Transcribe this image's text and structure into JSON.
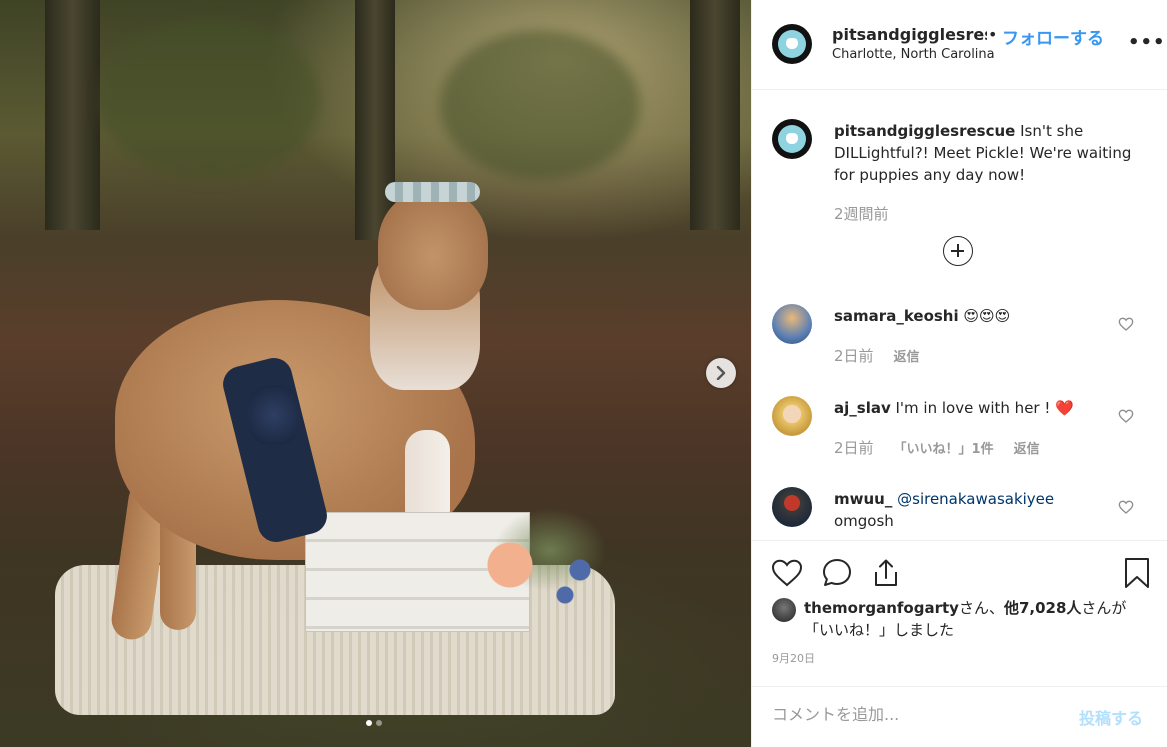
{
  "post": {
    "username": "pitsandgigglesrescue",
    "header_username_visible": "pitsandgigglesrescı",
    "follow_separator": "•",
    "follow_label": "フォローする",
    "location": "Charlotte, North Carolina",
    "more_label": "•••",
    "slide_count": 2,
    "active_slide": 1
  },
  "caption": {
    "username": "pitsandgigglesrescue",
    "text": " Isn't she DILLightful?! Meet Pickle! We're waiting for puppies any day now!",
    "time": "2週間前"
  },
  "comments": [
    {
      "username": "samara_keoshi",
      "text": " 😍😍😍",
      "time": "2日前",
      "reply_label": "返信",
      "likes_label": ""
    },
    {
      "username": "aj_slav",
      "text": " I'm in love with her ! ❤️",
      "time": "2日前",
      "likes_label": "「いいね！」1件",
      "reply_label": "返信"
    },
    {
      "username": "mwuu_",
      "mention": " @sirenakawasakiyee",
      "text": "omgosh"
    }
  ],
  "likes": {
    "liker": "themorganfogarty",
    "suffix1": "さん、",
    "others": "他7,028人",
    "suffix2": "さんが「いいね！」しました"
  },
  "date": "9月20日",
  "comment_box": {
    "placeholder": "コメントを追加...",
    "post_label": "投稿する"
  },
  "colors": {
    "accent": "#3897f0",
    "post_disabled": "#b2dffc",
    "muted": "#999999",
    "heart_red": "#ed4956"
  }
}
